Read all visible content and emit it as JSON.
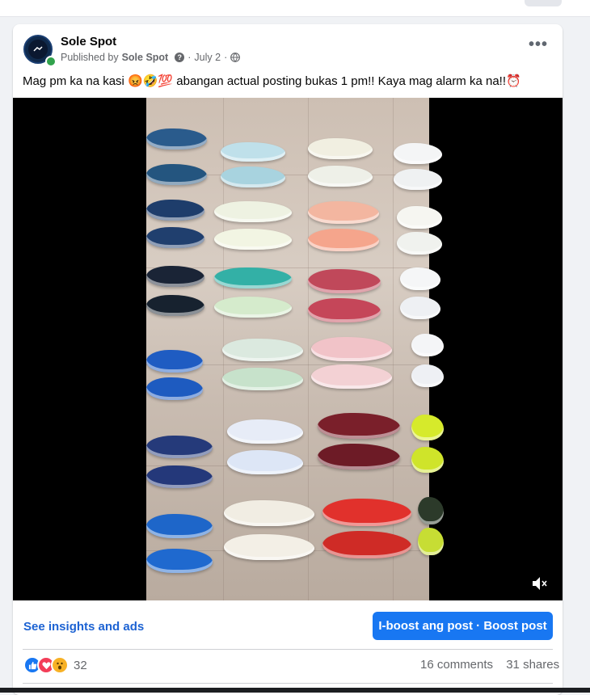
{
  "post": {
    "page_name": "Sole Spot",
    "published_prefix": "Published by",
    "published_by": "Sole Spot",
    "date": "July 2",
    "separator": "·",
    "more_label": "•••",
    "text": "Mag pm ka na kasi 😡🤣💯 abangan actual posting bukas 1 pm!! Kaya mag alarm ka na!!⏰",
    "icons": [
      "help-icon",
      "globe-icon",
      "mute-icon",
      "like-icon",
      "love-icon",
      "wow-icon"
    ]
  },
  "actions": {
    "insights_label": "See insights and ads",
    "boost_label": "I-boost ang post · Boost post"
  },
  "stats": {
    "reaction_count": "32",
    "comments": "16 comments",
    "shares": "31 shares"
  },
  "colors": {
    "accent": "#1877f2",
    "link": "#1d63d3",
    "online": "#31a24c"
  }
}
